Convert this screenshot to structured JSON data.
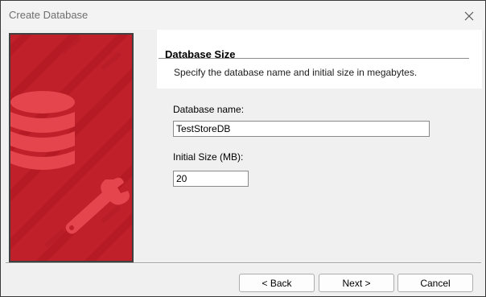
{
  "window": {
    "title": "Create Database"
  },
  "icons": {
    "close": "close-icon",
    "banner": "database-wrench-icon"
  },
  "colors": {
    "banner_red": "#c0202a",
    "banner_icon": "#e5454c"
  },
  "page": {
    "heading": "Database Size",
    "subheading": "Specify the database name and initial size in megabytes."
  },
  "form": {
    "name_label": "Database name:",
    "name_value": "TestStoreDB",
    "size_label": "Initial Size (MB):",
    "size_value": "20"
  },
  "buttons": {
    "back": "< Back",
    "next": "Next >",
    "cancel": "Cancel"
  }
}
